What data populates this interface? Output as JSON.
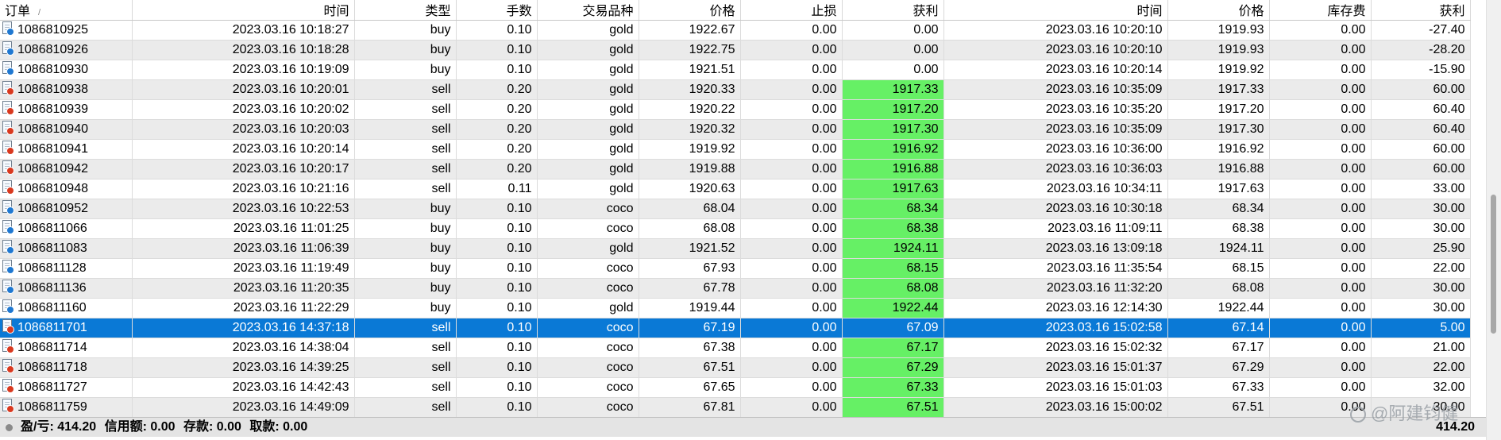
{
  "columns": [
    "订单",
    "时间",
    "类型",
    "手数",
    "交易品种",
    "价格",
    "止损",
    "获利",
    "时间",
    "价格",
    "库存费",
    "获利"
  ],
  "sort_indicator": "/",
  "rows": [
    {
      "order": "1086810925",
      "open_time": "2023.03.16 10:18:27",
      "type": "buy",
      "lots": "0.10",
      "symbol": "gold",
      "price": "1922.67",
      "sl": "0.00",
      "tp": "0.00",
      "close_time": "2023.03.16 10:20:10",
      "close_price": "1919.93",
      "swap": "0.00",
      "profit": "-27.40"
    },
    {
      "order": "1086810926",
      "open_time": "2023.03.16 10:18:28",
      "type": "buy",
      "lots": "0.10",
      "symbol": "gold",
      "price": "1922.75",
      "sl": "0.00",
      "tp": "0.00",
      "close_time": "2023.03.16 10:20:10",
      "close_price": "1919.93",
      "swap": "0.00",
      "profit": "-28.20"
    },
    {
      "order": "1086810930",
      "open_time": "2023.03.16 10:19:09",
      "type": "buy",
      "lots": "0.10",
      "symbol": "gold",
      "price": "1921.51",
      "sl": "0.00",
      "tp": "0.00",
      "close_time": "2023.03.16 10:20:14",
      "close_price": "1919.92",
      "swap": "0.00",
      "profit": "-15.90"
    },
    {
      "order": "1086810938",
      "open_time": "2023.03.16 10:20:01",
      "type": "sell",
      "lots": "0.20",
      "symbol": "gold",
      "price": "1920.33",
      "sl": "0.00",
      "tp": "1917.33",
      "close_time": "2023.03.16 10:35:09",
      "close_price": "1917.33",
      "swap": "0.00",
      "profit": "60.00"
    },
    {
      "order": "1086810939",
      "open_time": "2023.03.16 10:20:02",
      "type": "sell",
      "lots": "0.20",
      "symbol": "gold",
      "price": "1920.22",
      "sl": "0.00",
      "tp": "1917.20",
      "close_time": "2023.03.16 10:35:20",
      "close_price": "1917.20",
      "swap": "0.00",
      "profit": "60.40"
    },
    {
      "order": "1086810940",
      "open_time": "2023.03.16 10:20:03",
      "type": "sell",
      "lots": "0.20",
      "symbol": "gold",
      "price": "1920.32",
      "sl": "0.00",
      "tp": "1917.30",
      "close_time": "2023.03.16 10:35:09",
      "close_price": "1917.30",
      "swap": "0.00",
      "profit": "60.40"
    },
    {
      "order": "1086810941",
      "open_time": "2023.03.16 10:20:14",
      "type": "sell",
      "lots": "0.20",
      "symbol": "gold",
      "price": "1919.92",
      "sl": "0.00",
      "tp": "1916.92",
      "close_time": "2023.03.16 10:36:00",
      "close_price": "1916.92",
      "swap": "0.00",
      "profit": "60.00"
    },
    {
      "order": "1086810942",
      "open_time": "2023.03.16 10:20:17",
      "type": "sell",
      "lots": "0.20",
      "symbol": "gold",
      "price": "1919.88",
      "sl": "0.00",
      "tp": "1916.88",
      "close_time": "2023.03.16 10:36:03",
      "close_price": "1916.88",
      "swap": "0.00",
      "profit": "60.00"
    },
    {
      "order": "1086810948",
      "open_time": "2023.03.16 10:21:16",
      "type": "sell",
      "lots": "0.11",
      "symbol": "gold",
      "price": "1920.63",
      "sl": "0.00",
      "tp": "1917.63",
      "close_time": "2023.03.16 10:34:11",
      "close_price": "1917.63",
      "swap": "0.00",
      "profit": "33.00"
    },
    {
      "order": "1086810952",
      "open_time": "2023.03.16 10:22:53",
      "type": "buy",
      "lots": "0.10",
      "symbol": "coco",
      "price": "68.04",
      "sl": "0.00",
      "tp": "68.34",
      "close_time": "2023.03.16 10:30:18",
      "close_price": "68.34",
      "swap": "0.00",
      "profit": "30.00"
    },
    {
      "order": "1086811066",
      "open_time": "2023.03.16 11:01:25",
      "type": "buy",
      "lots": "0.10",
      "symbol": "coco",
      "price": "68.08",
      "sl": "0.00",
      "tp": "68.38",
      "close_time": "2023.03.16 11:09:11",
      "close_price": "68.38",
      "swap": "0.00",
      "profit": "30.00"
    },
    {
      "order": "1086811083",
      "open_time": "2023.03.16 11:06:39",
      "type": "buy",
      "lots": "0.10",
      "symbol": "gold",
      "price": "1921.52",
      "sl": "0.00",
      "tp": "1924.11",
      "close_time": "2023.03.16 13:09:18",
      "close_price": "1924.11",
      "swap": "0.00",
      "profit": "25.90"
    },
    {
      "order": "1086811128",
      "open_time": "2023.03.16 11:19:49",
      "type": "buy",
      "lots": "0.10",
      "symbol": "coco",
      "price": "67.93",
      "sl": "0.00",
      "tp": "68.15",
      "close_time": "2023.03.16 11:35:54",
      "close_price": "68.15",
      "swap": "0.00",
      "profit": "22.00"
    },
    {
      "order": "1086811136",
      "open_time": "2023.03.16 11:20:35",
      "type": "buy",
      "lots": "0.10",
      "symbol": "coco",
      "price": "67.78",
      "sl": "0.00",
      "tp": "68.08",
      "close_time": "2023.03.16 11:32:20",
      "close_price": "68.08",
      "swap": "0.00",
      "profit": "30.00"
    },
    {
      "order": "1086811160",
      "open_time": "2023.03.16 11:22:29",
      "type": "buy",
      "lots": "0.10",
      "symbol": "gold",
      "price": "1919.44",
      "sl": "0.00",
      "tp": "1922.44",
      "close_time": "2023.03.16 12:14:30",
      "close_price": "1922.44",
      "swap": "0.00",
      "profit": "30.00"
    },
    {
      "order": "1086811701",
      "open_time": "2023.03.16 14:37:18",
      "type": "sell",
      "lots": "0.10",
      "symbol": "coco",
      "price": "67.19",
      "sl": "0.00",
      "tp": "67.09",
      "close_time": "2023.03.16 15:02:58",
      "close_price": "67.14",
      "swap": "0.00",
      "profit": "5.00"
    },
    {
      "order": "1086811714",
      "open_time": "2023.03.16 14:38:04",
      "type": "sell",
      "lots": "0.10",
      "symbol": "coco",
      "price": "67.38",
      "sl": "0.00",
      "tp": "67.17",
      "close_time": "2023.03.16 15:02:32",
      "close_price": "67.17",
      "swap": "0.00",
      "profit": "21.00"
    },
    {
      "order": "1086811718",
      "open_time": "2023.03.16 14:39:25",
      "type": "sell",
      "lots": "0.10",
      "symbol": "coco",
      "price": "67.51",
      "sl": "0.00",
      "tp": "67.29",
      "close_time": "2023.03.16 15:01:37",
      "close_price": "67.29",
      "swap": "0.00",
      "profit": "22.00"
    },
    {
      "order": "1086811727",
      "open_time": "2023.03.16 14:42:43",
      "type": "sell",
      "lots": "0.10",
      "symbol": "coco",
      "price": "67.65",
      "sl": "0.00",
      "tp": "67.33",
      "close_time": "2023.03.16 15:01:03",
      "close_price": "67.33",
      "swap": "0.00",
      "profit": "32.00"
    },
    {
      "order": "1086811759",
      "open_time": "2023.03.16 14:49:09",
      "type": "sell",
      "lots": "0.10",
      "symbol": "coco",
      "price": "67.81",
      "sl": "0.00",
      "tp": "67.51",
      "close_time": "2023.03.16 15:00:02",
      "close_price": "67.51",
      "swap": "0.00",
      "profit": "30.00"
    }
  ],
  "selected_order": "1086811701",
  "highlight_tp_color": "#66f065",
  "selection_color": "#0a79d6",
  "footer": {
    "profit_label": "盈/亏: 414.20",
    "credit_label": "信用额: 0.00",
    "deposit_label": "存款: 0.00",
    "withdraw_label": "取款: 0.00",
    "total": "414.20"
  },
  "watermark": "@阿建钧健"
}
